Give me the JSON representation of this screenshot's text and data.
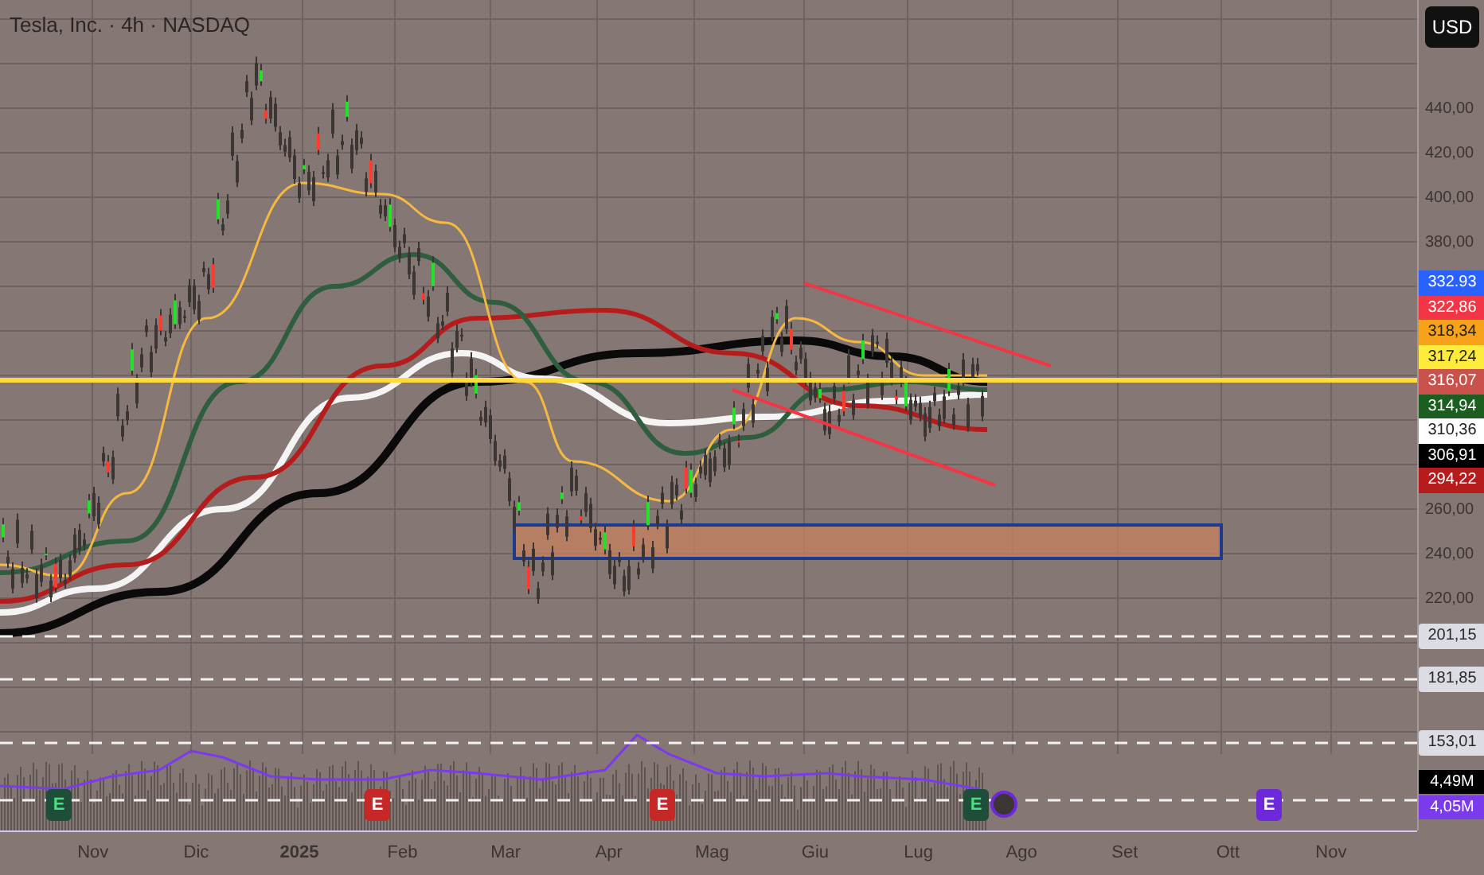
{
  "title": "Tesla, Inc. · 4h · NASDAQ",
  "currency": "USD",
  "price_axis": [
    "440,00",
    "420,00",
    "400,00",
    "380,00",
    "260,00",
    "240,00",
    "220,00"
  ],
  "price_tags": [
    {
      "label": "332.93",
      "color": "#2962ff"
    },
    {
      "label": "322,86",
      "color": "#f23645"
    },
    {
      "label": "318,34",
      "color": "#f7a21b"
    },
    {
      "label": "317,24",
      "color": "#ffeb3b"
    },
    {
      "label": "316,07",
      "color": "#c9524c"
    },
    {
      "label": "314,94",
      "color": "#1b5e20"
    },
    {
      "label": "310,36",
      "color": "#ffffff"
    },
    {
      "label": "306,91",
      "color": "#000000"
    },
    {
      "label": "294,22",
      "color": "#b71c1c"
    }
  ],
  "line_labels": [
    {
      "label": "201,15"
    },
    {
      "label": "181,85"
    },
    {
      "label": "153,01"
    }
  ],
  "volume_tags": [
    {
      "label": "4,49M",
      "color": "#000000"
    },
    {
      "label": "4,05M",
      "color": "#7c3aed"
    }
  ],
  "earnings": [
    {
      "label": "E",
      "color": "#1e4d3a"
    },
    {
      "label": "E",
      "color": "#c62828"
    },
    {
      "label": "E",
      "color": "#c62828"
    },
    {
      "label": "E",
      "color": "#1e4d3a"
    },
    {
      "label": "E",
      "color": "#6d28d9"
    }
  ],
  "time_axis": [
    "Nov",
    "Dic",
    "2025",
    "Feb",
    "Mar",
    "Apr",
    "Mag",
    "Giu",
    "Lug",
    "Ago",
    "Set",
    "Ott",
    "Nov"
  ]
}
